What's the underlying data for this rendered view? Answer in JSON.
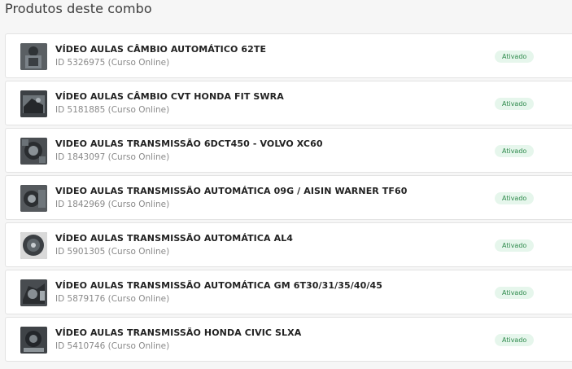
{
  "section_title": "Produtos deste combo",
  "products": [
    {
      "title": "VÍDEO AULAS CÂMBIO AUTOMÁTICO 62TE",
      "meta": "ID 5326975 (Curso Online)",
      "status": "Ativado"
    },
    {
      "title": "VÍDEO AULAS CÂMBIO CVT HONDA FIT SWRA",
      "meta": "ID 5181885 (Curso Online)",
      "status": "Ativado"
    },
    {
      "title": "VIDEO AULAS TRANSMISSÃO 6DCT450 - VOLVO XC60",
      "meta": "ID 1843097 (Curso Online)",
      "status": "Ativado"
    },
    {
      "title": "VIDEO AULAS TRANSMISSÃO AUTOMÁTICA 09G / AISIN WARNER TF60",
      "meta": "ID 1842969 (Curso Online)",
      "status": "Ativado"
    },
    {
      "title": "VÍDEO AULAS TRANSMISSÃO AUTOMÁTICA AL4",
      "meta": "ID 5901305 (Curso Online)",
      "status": "Ativado"
    },
    {
      "title": "VÍDEO AULAS TRANSMISSÃO AUTOMÁTICA GM 6T30/31/35/40/45",
      "meta": "ID 5879176 (Curso Online)",
      "status": "Ativado"
    },
    {
      "title": "VÍDEO AULAS TRANSMISSÃO HONDA CIVIC SLXA",
      "meta": "ID 5410746 (Curso Online)",
      "status": "Ativado"
    }
  ],
  "colors": {
    "badge_bg": "#e6f6ec",
    "badge_text": "#2e8a4c"
  }
}
